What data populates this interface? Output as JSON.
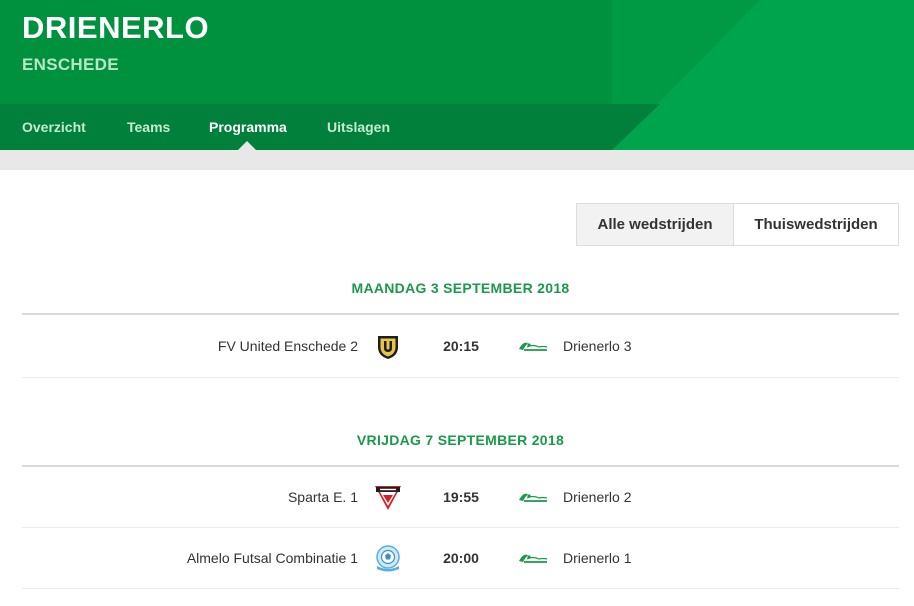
{
  "header": {
    "title": "DRIENERLO",
    "subtitle": "ENSCHEDE",
    "brand_color": "#00913f"
  },
  "nav": {
    "items": [
      {
        "label": "Overzicht",
        "active": false
      },
      {
        "label": "Teams",
        "active": false
      },
      {
        "label": "Programma",
        "active": true
      },
      {
        "label": "Uitslagen",
        "active": false
      }
    ]
  },
  "filters": {
    "all_label": "Alle wedstrijden",
    "home_label": "Thuiswedstrijden",
    "selected": "Alle wedstrijden"
  },
  "schedule": [
    {
      "date": "MAANDAG 3 SEPTEMBER 2018",
      "matches": [
        {
          "home": "FV United Enschede 2",
          "home_logo": "united-shield-icon",
          "time": "20:15",
          "away": "Drienerlo 3",
          "away_logo": "drienerlo-logo-icon"
        }
      ]
    },
    {
      "date": "VRIJDAG 7 SEPTEMBER 2018",
      "matches": [
        {
          "home": "Sparta E. 1",
          "home_logo": "sparta-triangle-icon",
          "time": "19:55",
          "away": "Drienerlo 2",
          "away_logo": "drienerlo-logo-icon"
        },
        {
          "home": "Almelo Futsal Combinatie 1",
          "home_logo": "almelo-futsal-icon",
          "time": "20:00",
          "away": "Drienerlo 1",
          "away_logo": "drienerlo-logo-icon"
        }
      ]
    }
  ],
  "colors": {
    "accent_green": "#1a9a48",
    "header_green": "#00913f",
    "nav_green": "#00803a"
  }
}
